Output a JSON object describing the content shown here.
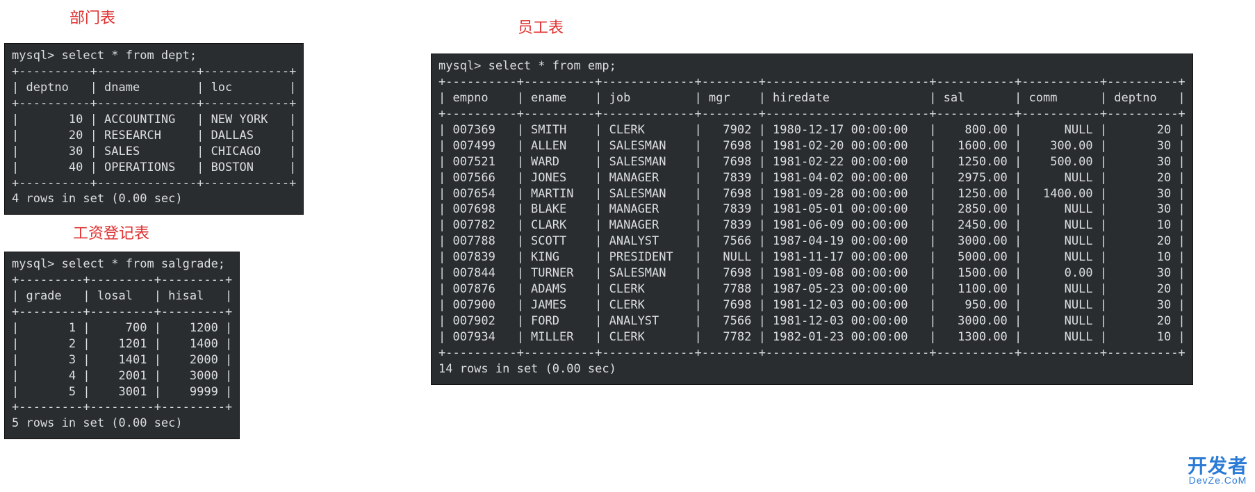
{
  "titles": {
    "dept": "部门表",
    "emp": "员工表",
    "salgrade": "工资登记表"
  },
  "dept": {
    "query": "mysql> select * from dept;",
    "columns": [
      "deptno",
      "dname",
      "loc"
    ],
    "widths": [
      8,
      12,
      10
    ],
    "aligns": [
      "r",
      "l",
      "l"
    ],
    "rows": [
      [
        "10",
        "ACCOUNTING",
        "NEW YORK"
      ],
      [
        "20",
        "RESEARCH",
        "DALLAS"
      ],
      [
        "30",
        "SALES",
        "CHICAGO"
      ],
      [
        "40",
        "OPERATIONS",
        "BOSTON"
      ]
    ],
    "footer": "4 rows in set (0.00 sec)"
  },
  "salgrade": {
    "query": "mysql> select * from salgrade;",
    "columns": [
      "grade",
      "losal",
      "hisal"
    ],
    "widths": [
      7,
      7,
      7
    ],
    "aligns": [
      "r",
      "r",
      "r"
    ],
    "rows": [
      [
        "1",
        "700",
        "1200"
      ],
      [
        "2",
        "1201",
        "1400"
      ],
      [
        "3",
        "1401",
        "2000"
      ],
      [
        "4",
        "2001",
        "3000"
      ],
      [
        "5",
        "3001",
        "9999"
      ]
    ],
    "footer": "5 rows in set (0.00 sec)"
  },
  "emp": {
    "query": "mysql> select * from emp;",
    "columns": [
      "empno",
      "ename",
      "job",
      "mgr",
      "hiredate",
      "sal",
      "comm",
      "deptno"
    ],
    "widths": [
      8,
      8,
      11,
      6,
      21,
      9,
      9,
      8
    ],
    "aligns": [
      "l",
      "l",
      "l",
      "r",
      "l",
      "r",
      "r",
      "r"
    ],
    "rows": [
      [
        "007369",
        "SMITH",
        "CLERK",
        "7902",
        "1980-12-17 00:00:00",
        "800.00",
        "NULL",
        "20"
      ],
      [
        "007499",
        "ALLEN",
        "SALESMAN",
        "7698",
        "1981-02-20 00:00:00",
        "1600.00",
        "300.00",
        "30"
      ],
      [
        "007521",
        "WARD",
        "SALESMAN",
        "7698",
        "1981-02-22 00:00:00",
        "1250.00",
        "500.00",
        "30"
      ],
      [
        "007566",
        "JONES",
        "MANAGER",
        "7839",
        "1981-04-02 00:00:00",
        "2975.00",
        "NULL",
        "20"
      ],
      [
        "007654",
        "MARTIN",
        "SALESMAN",
        "7698",
        "1981-09-28 00:00:00",
        "1250.00",
        "1400.00",
        "30"
      ],
      [
        "007698",
        "BLAKE",
        "MANAGER",
        "7839",
        "1981-05-01 00:00:00",
        "2850.00",
        "NULL",
        "30"
      ],
      [
        "007782",
        "CLARK",
        "MANAGER",
        "7839",
        "1981-06-09 00:00:00",
        "2450.00",
        "NULL",
        "10"
      ],
      [
        "007788",
        "SCOTT",
        "ANALYST",
        "7566",
        "1987-04-19 00:00:00",
        "3000.00",
        "NULL",
        "20"
      ],
      [
        "007839",
        "KING",
        "PRESIDENT",
        "NULL",
        "1981-11-17 00:00:00",
        "5000.00",
        "NULL",
        "10"
      ],
      [
        "007844",
        "TURNER",
        "SALESMAN",
        "7698",
        "1981-09-08 00:00:00",
        "1500.00",
        "0.00",
        "30"
      ],
      [
        "007876",
        "ADAMS",
        "CLERK",
        "7788",
        "1987-05-23 00:00:00",
        "1100.00",
        "NULL",
        "20"
      ],
      [
        "007900",
        "JAMES",
        "CLERK",
        "7698",
        "1981-12-03 00:00:00",
        "950.00",
        "NULL",
        "30"
      ],
      [
        "007902",
        "FORD",
        "ANALYST",
        "7566",
        "1981-12-03 00:00:00",
        "3000.00",
        "NULL",
        "20"
      ],
      [
        "007934",
        "MILLER",
        "CLERK",
        "7782",
        "1982-01-23 00:00:00",
        "1300.00",
        "NULL",
        "10"
      ]
    ],
    "footer": "14 rows in set (0.00 sec)"
  },
  "watermark": {
    "main": "开发者",
    "sub": "DevZe.CoM"
  }
}
